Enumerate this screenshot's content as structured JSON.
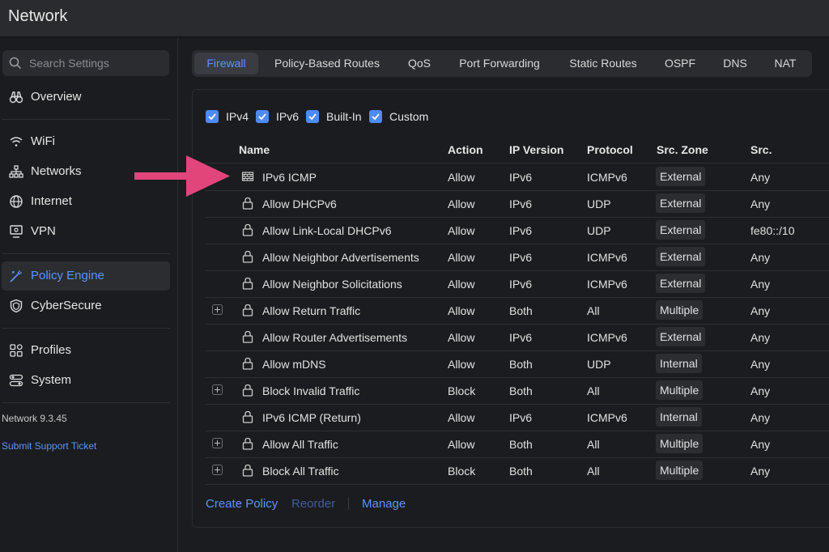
{
  "app": {
    "title": "Network"
  },
  "search": {
    "placeholder": "Search Settings"
  },
  "sidebar": {
    "items": [
      {
        "label": "Overview",
        "icon": "binoculars-icon"
      },
      {
        "label": "WiFi",
        "icon": "wifi-icon"
      },
      {
        "label": "Networks",
        "icon": "network-topology-icon"
      },
      {
        "label": "Internet",
        "icon": "globe-icon"
      },
      {
        "label": "VPN",
        "icon": "vpn-monitor-icon"
      },
      {
        "label": "Policy Engine",
        "icon": "policy-wand-icon",
        "active": true
      },
      {
        "label": "CyberSecure",
        "icon": "shield-icon"
      },
      {
        "label": "Profiles",
        "icon": "profiles-grid-icon"
      },
      {
        "label": "System",
        "icon": "system-toggles-icon"
      }
    ],
    "version": "Network 9.3.45",
    "support": "Submit Support Ticket"
  },
  "tabs": [
    "Firewall",
    "Policy-Based Routes",
    "QoS",
    "Port Forwarding",
    "Static Routes",
    "OSPF",
    "DNS",
    "NAT"
  ],
  "filters": [
    "IPv4",
    "IPv6",
    "Built-In",
    "Custom"
  ],
  "table": {
    "headers": [
      "Name",
      "Action",
      "IP Version",
      "Protocol",
      "Src. Zone",
      "Src."
    ],
    "rows": [
      {
        "name": "IPv6 ICMP",
        "action": "Allow",
        "ipver": "IPv6",
        "proto": "ICMPv6",
        "zone": "External",
        "src": "Any",
        "icon": "firewall-icon",
        "expand": false
      },
      {
        "name": "Allow DHCPv6",
        "action": "Allow",
        "ipver": "IPv6",
        "proto": "UDP",
        "zone": "External",
        "src": "Any",
        "icon": "lock-icon",
        "expand": false
      },
      {
        "name": "Allow Link-Local DHCPv6",
        "action": "Allow",
        "ipver": "IPv6",
        "proto": "UDP",
        "zone": "External",
        "src": "fe80::/10",
        "icon": "lock-icon",
        "expand": false
      },
      {
        "name": "Allow Neighbor Advertisements",
        "action": "Allow",
        "ipver": "IPv6",
        "proto": "ICMPv6",
        "zone": "External",
        "src": "Any",
        "icon": "lock-icon",
        "expand": false
      },
      {
        "name": "Allow Neighbor Solicitations",
        "action": "Allow",
        "ipver": "IPv6",
        "proto": "ICMPv6",
        "zone": "External",
        "src": "Any",
        "icon": "lock-icon",
        "expand": false
      },
      {
        "name": "Allow Return Traffic",
        "action": "Allow",
        "ipver": "Both",
        "proto": "All",
        "zone": "Multiple",
        "src": "Any",
        "icon": "lock-icon",
        "expand": true
      },
      {
        "name": "Allow Router Advertisements",
        "action": "Allow",
        "ipver": "IPv6",
        "proto": "ICMPv6",
        "zone": "External",
        "src": "Any",
        "icon": "lock-icon",
        "expand": false
      },
      {
        "name": "Allow mDNS",
        "action": "Allow",
        "ipver": "Both",
        "proto": "UDP",
        "zone": "Internal",
        "src": "Any",
        "icon": "lock-icon",
        "expand": false
      },
      {
        "name": "Block Invalid Traffic",
        "action": "Block",
        "ipver": "Both",
        "proto": "All",
        "zone": "Multiple",
        "src": "Any",
        "icon": "lock-icon",
        "expand": true
      },
      {
        "name": "IPv6 ICMP (Return)",
        "action": "Allow",
        "ipver": "IPv6",
        "proto": "ICMPv6",
        "zone": "Internal",
        "src": "Any",
        "icon": "lock-icon",
        "expand": false
      },
      {
        "name": "Allow All Traffic",
        "action": "Allow",
        "ipver": "Both",
        "proto": "All",
        "zone": "Multiple",
        "src": "Any",
        "icon": "lock-icon",
        "expand": true
      },
      {
        "name": "Block All Traffic",
        "action": "Block",
        "ipver": "Both",
        "proto": "All",
        "zone": "Multiple",
        "src": "Any",
        "icon": "lock-icon",
        "expand": true
      }
    ]
  },
  "footer": {
    "create": "Create Policy",
    "reorder": "Reorder",
    "manage": "Manage"
  },
  "colors": {
    "accent": "#5b95ff",
    "checkbox": "#4d8bf5",
    "annotation_arrow": "#e2457a",
    "background": "#1b1c1f"
  }
}
